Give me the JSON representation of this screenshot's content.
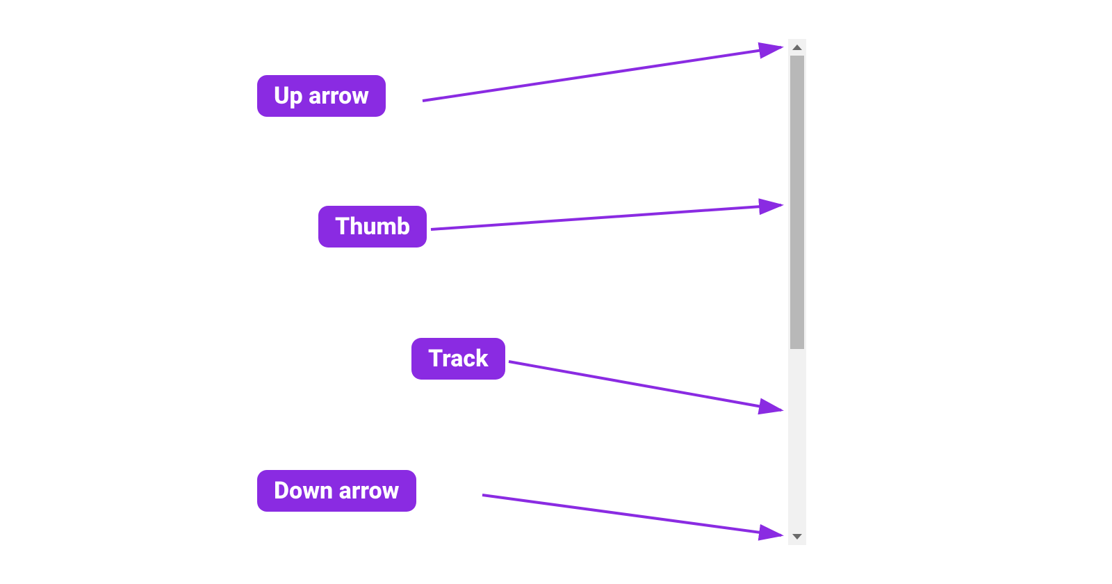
{
  "labels": {
    "up_arrow": "Up arrow",
    "thumb": "Thumb",
    "track": "Track",
    "down_arrow": "Down arrow"
  },
  "colors": {
    "accent": "#8a2be2",
    "track": "#f1f1f1",
    "thumb": "#b8b8b8",
    "arrow_glyph": "#6b6b6b"
  },
  "scrollbar": {
    "orientation": "vertical",
    "parts": [
      "up-arrow-button",
      "thumb",
      "track",
      "down-arrow-button"
    ],
    "thumb_position": "top",
    "thumb_fraction": 0.62
  }
}
